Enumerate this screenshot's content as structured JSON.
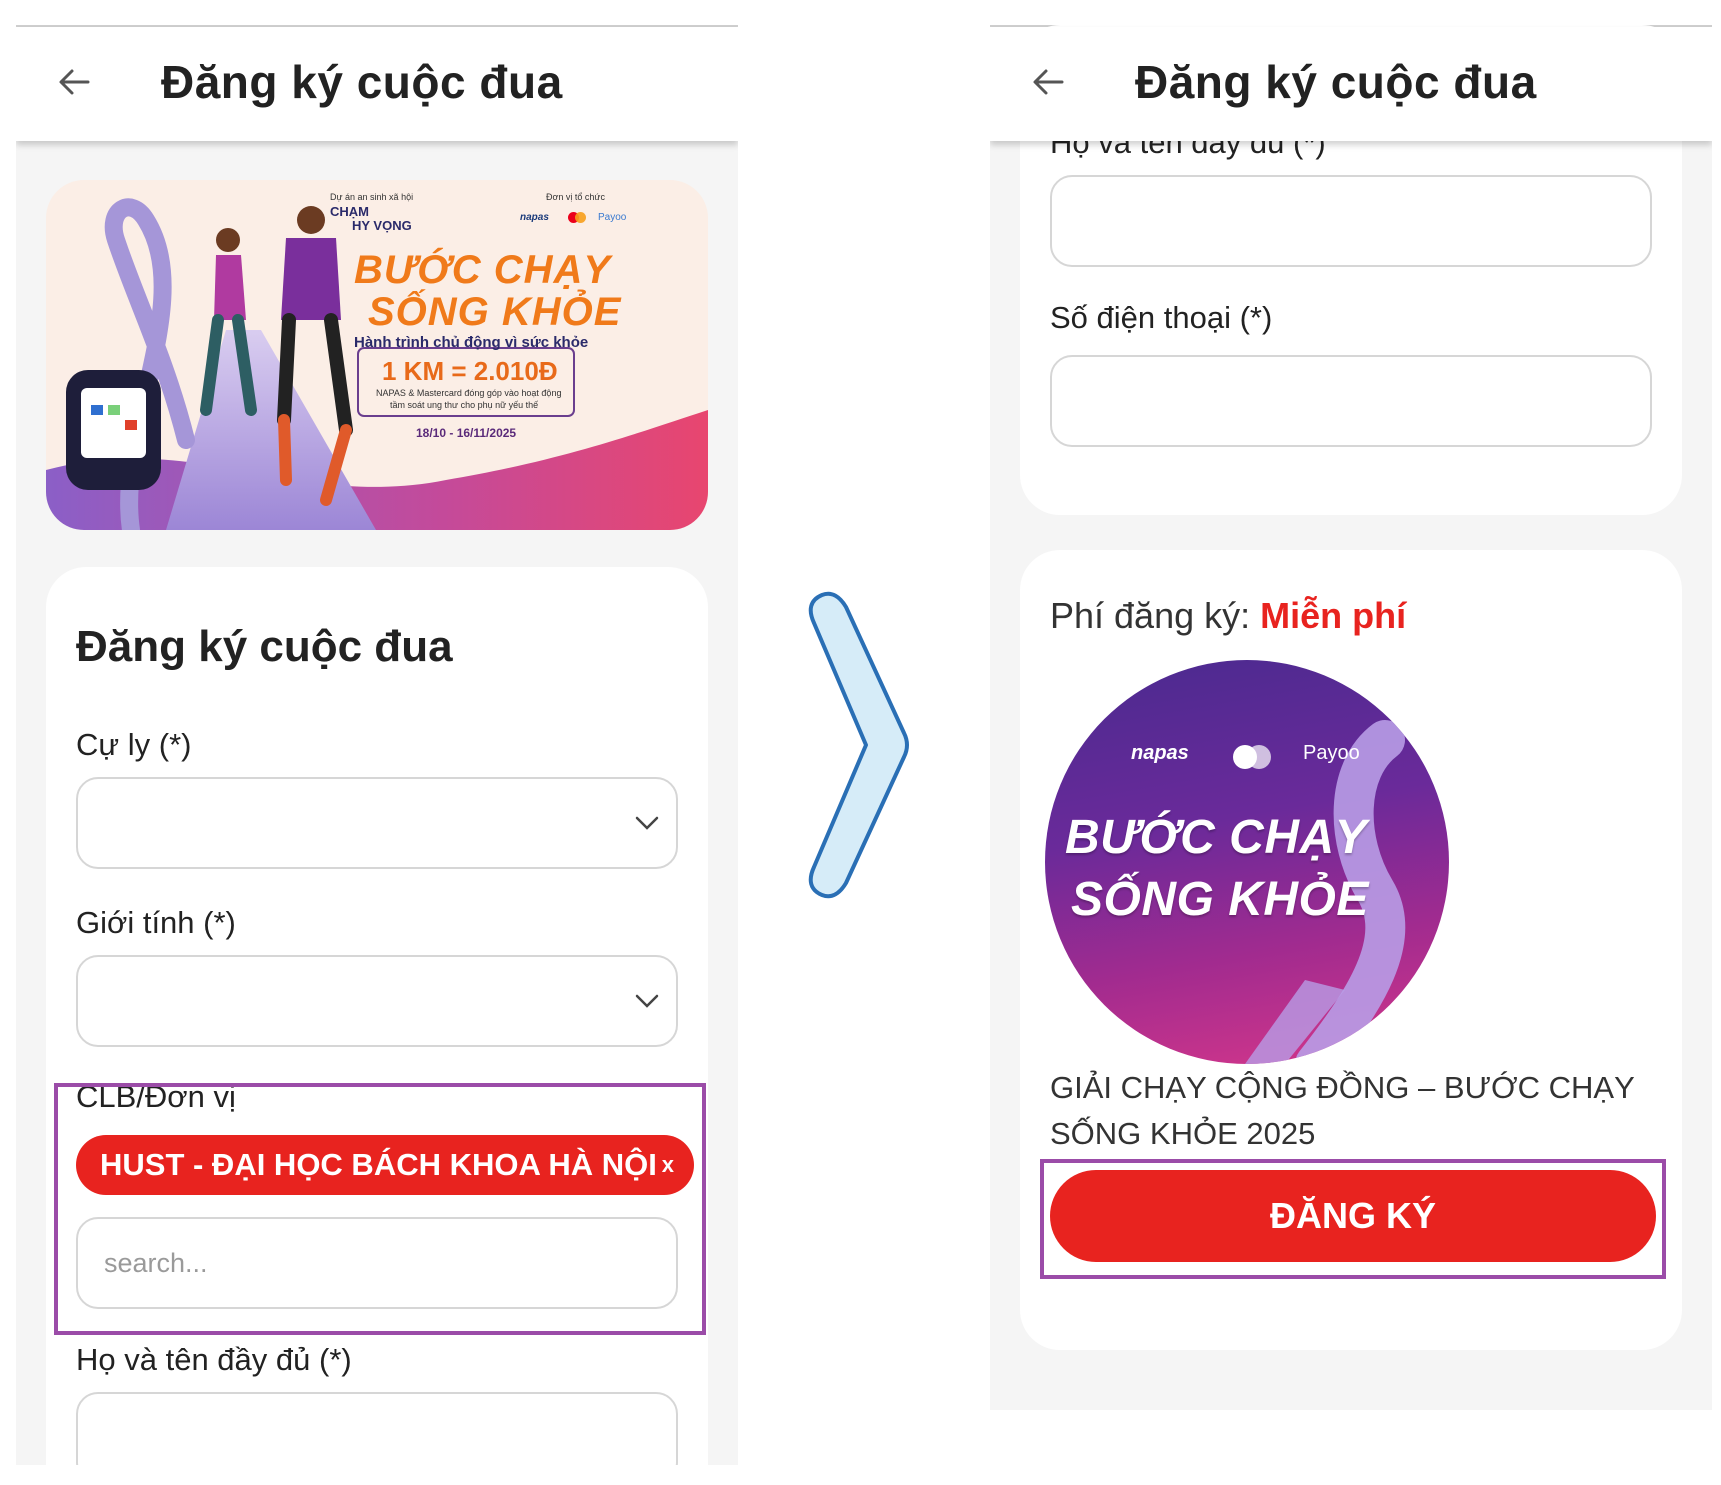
{
  "left": {
    "appbar_title": "Đăng ký cuộc đua",
    "banner": {
      "project_label": "Dự án an sinh xã hội",
      "project_name_1": "CHẠM",
      "project_name_2": "HY VỌNG",
      "organizer_label": "Đơn vị tổ chức",
      "sponsor_1": "napas",
      "sponsor_3": "Payoo",
      "headline_1": "BƯỚC CHẠY",
      "headline_2": "SỐNG KHỎE",
      "tagline": "Hành trình chủ động vì sức khỏe",
      "rate": "1 KM = 2.010Đ",
      "note_1": "NAPAS & Mastercard đóng góp vào hoạt động",
      "note_2": "tầm soát ung thư cho phụ nữ yếu thế",
      "dates": "18/10 - 16/11/2025"
    },
    "form_title": "Đăng ký cuộc đua",
    "distance_label": "Cự ly (*)",
    "gender_label": "Giới tính (*)",
    "club_label": "CLB/Đơn vị",
    "club_chip": "HUST - ĐẠI HỌC BÁCH KHOA HÀ NỘI",
    "chip_remove": "x",
    "search_placeholder": "search...",
    "fullname_label": "Họ và tên đầy đủ (*)"
  },
  "right": {
    "appbar_title": "Đăng ký cuộc đua",
    "fullname_label_partial": "Họ và tên đầy đủ (*)",
    "phone_label": "Số điện thoại (*)",
    "fee_label": "Phí đăng ký: ",
    "fee_value": "Miễn phí",
    "event_logo": {
      "sponsor_1": "napas",
      "sponsor_3": "Payoo",
      "headline_1": "BƯỚC CHẠY",
      "headline_2": "SỐNG KHỎE"
    },
    "event_name": "GIẢI CHẠY CỘNG ĐỒNG – BƯỚC CHẠY SỐNG KHỎE 2025",
    "register_button": "ĐĂNG KÝ"
  },
  "colors": {
    "primary_red": "#e8231f",
    "highlight_purple": "#9b4ca8",
    "arrow_fill": "#d6ecf8",
    "arrow_stroke": "#2a6fb5",
    "banner_orange": "#f07a1a"
  }
}
